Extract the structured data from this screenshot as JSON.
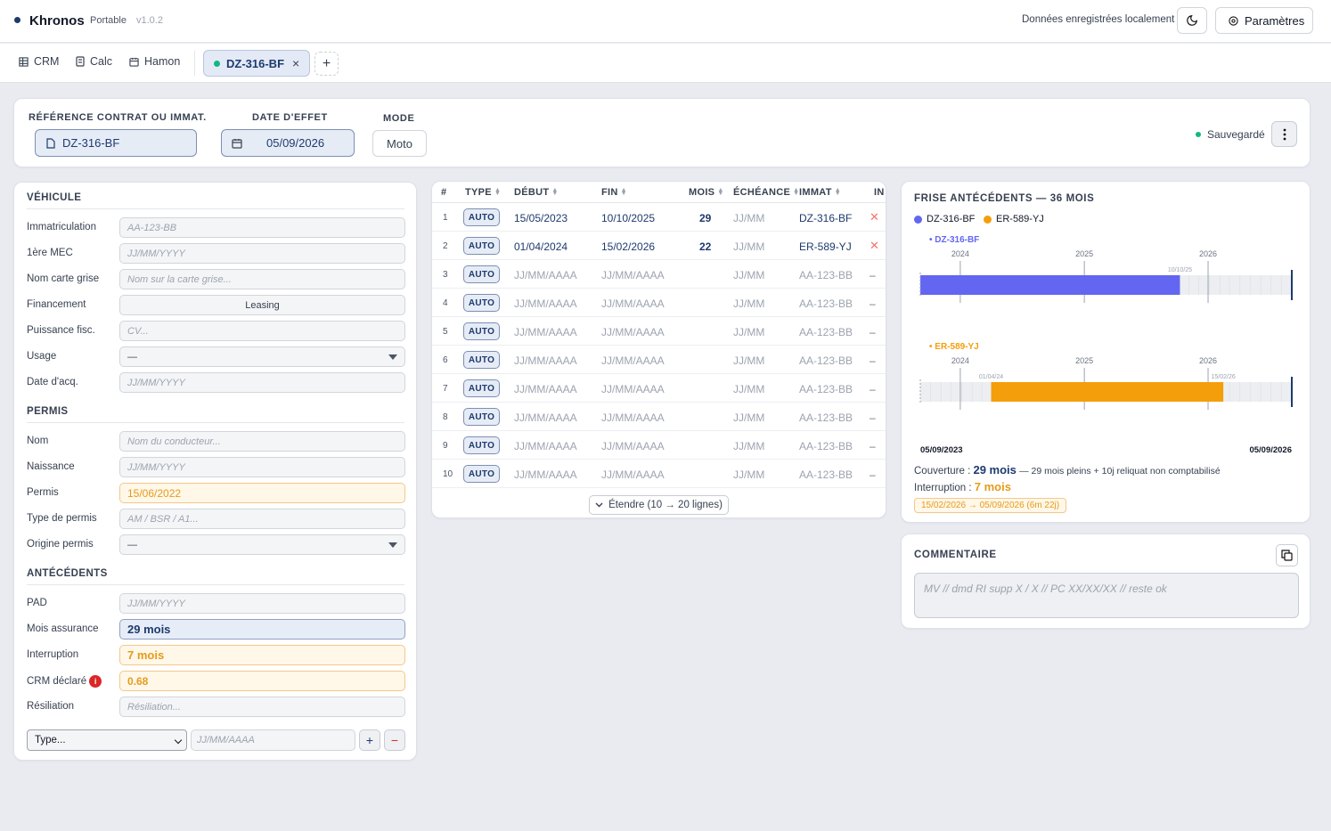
{
  "app": {
    "name": "Khronos",
    "edition": "Portable",
    "version": "v1.0.2",
    "storage_note": "Données enregistrées localement",
    "settings_label": "Paramètres"
  },
  "tabs": {
    "items": [
      {
        "label": "CRM"
      },
      {
        "label": "Calc"
      },
      {
        "label": "Hamon"
      }
    ],
    "active": {
      "label": "DZ-316-BF",
      "close": "×"
    },
    "add": "+"
  },
  "header": {
    "ref_label": "RÉFÉRENCE CONTRAT OU IMMAT.",
    "ref_value": "DZ-316-BF",
    "date_label": "DATE D'EFFET",
    "date_value": "05/09/2026",
    "mode_label": "MODE",
    "mode_value": "Moto",
    "status": "Sauvegardé"
  },
  "vehicule": {
    "title": "VÉHICULE",
    "fields": [
      {
        "label": "Immatriculation",
        "placeholder": "AA-123-BB"
      },
      {
        "label": "1ère MEC",
        "placeholder": "JJ/MM/YYYY"
      },
      {
        "label": "Nom carte grise",
        "placeholder": "Nom sur la carte grise..."
      },
      {
        "label": "Financement",
        "value": "Leasing"
      },
      {
        "label": "Puissance fisc.",
        "placeholder": "CV..."
      },
      {
        "label": "Usage",
        "value": "—"
      },
      {
        "label": "Date d'acq.",
        "placeholder": "JJ/MM/YYYY"
      }
    ]
  },
  "permis": {
    "title": "PERMIS",
    "fields": [
      {
        "label": "Nom",
        "placeholder": "Nom du conducteur..."
      },
      {
        "label": "Naissance",
        "placeholder": "JJ/MM/YYYY"
      },
      {
        "label": "Permis",
        "value": "15/06/2022"
      },
      {
        "label": "Type de permis",
        "placeholder": "AM / BSR / A1..."
      },
      {
        "label": "Origine permis",
        "value": "—"
      }
    ]
  },
  "antecedents": {
    "title": "ANTÉCÉDENTS",
    "fields": [
      {
        "label": "PAD",
        "placeholder": "JJ/MM/YYYY"
      },
      {
        "label": "Mois assurance",
        "value": "29 mois"
      },
      {
        "label": "Interruption",
        "value": "7 mois"
      },
      {
        "label": "CRM déclaré",
        "value": "0.68",
        "badge": "i"
      },
      {
        "label": "Résiliation",
        "placeholder": "Résiliation..."
      }
    ],
    "type_select": "Type...",
    "date_placeholder": "JJ/MM/AAAA",
    "add": "+",
    "remove": "−"
  },
  "table": {
    "headers": [
      "#",
      "TYPE",
      "DÉBUT",
      "FIN",
      "MOIS",
      "ÉCHÉANCE",
      "IMMAT",
      "IN"
    ],
    "rows": [
      {
        "n": "1",
        "type": "AUTO",
        "debut": "15/05/2023",
        "fin": "10/10/2025",
        "mois": "29",
        "echeance": "JJ/MM",
        "immat": "DZ-316-BF",
        "action": "✕"
      },
      {
        "n": "2",
        "type": "AUTO",
        "debut": "01/04/2024",
        "fin": "15/02/2026",
        "mois": "22",
        "echeance": "JJ/MM",
        "immat": "ER-589-YJ",
        "action": "✕"
      },
      {
        "n": "3",
        "type": "AUTO",
        "debut": "JJ/MM/AAAA",
        "fin": "JJ/MM/AAAA",
        "mois": "",
        "echeance": "JJ/MM",
        "immat": "AA-123-BB",
        "action": "–"
      },
      {
        "n": "4",
        "type": "AUTO",
        "debut": "JJ/MM/AAAA",
        "fin": "JJ/MM/AAAA",
        "mois": "",
        "echeance": "JJ/MM",
        "immat": "AA-123-BB",
        "action": "–"
      },
      {
        "n": "5",
        "type": "AUTO",
        "debut": "JJ/MM/AAAA",
        "fin": "JJ/MM/AAAA",
        "mois": "",
        "echeance": "JJ/MM",
        "immat": "AA-123-BB",
        "action": "–"
      },
      {
        "n": "6",
        "type": "AUTO",
        "debut": "JJ/MM/AAAA",
        "fin": "JJ/MM/AAAA",
        "mois": "",
        "echeance": "JJ/MM",
        "immat": "AA-123-BB",
        "action": "–"
      },
      {
        "n": "7",
        "type": "AUTO",
        "debut": "JJ/MM/AAAA",
        "fin": "JJ/MM/AAAA",
        "mois": "",
        "echeance": "JJ/MM",
        "immat": "AA-123-BB",
        "action": "–"
      },
      {
        "n": "8",
        "type": "AUTO",
        "debut": "JJ/MM/AAAA",
        "fin": "JJ/MM/AAAA",
        "mois": "",
        "echeance": "JJ/MM",
        "immat": "AA-123-BB",
        "action": "–"
      },
      {
        "n": "9",
        "type": "AUTO",
        "debut": "JJ/MM/AAAA",
        "fin": "JJ/MM/AAAA",
        "mois": "",
        "echeance": "JJ/MM",
        "immat": "AA-123-BB",
        "action": "–"
      },
      {
        "n": "10",
        "type": "AUTO",
        "debut": "JJ/MM/AAAA",
        "fin": "JJ/MM/AAAA",
        "mois": "",
        "echeance": "JJ/MM",
        "immat": "AA-123-BB",
        "action": "–"
      }
    ],
    "expand_label": "Étendre (10 → 20 lignes)"
  },
  "frise": {
    "title": "FRISE ANTÉCÉDENTS — 36 MOIS",
    "start_label": "05/09/2023",
    "end_label": "05/09/2026",
    "couverture_label": "Couverture :",
    "couverture_value": "29 mois",
    "couverture_detail": "— 29 mois pleins + 10j reliquat non comptabilisé",
    "interruption_label": "Interruption :",
    "interruption_value": "7 mois",
    "gap_chip": "15/02/2026 → 05/09/2026 (6m 22j)"
  },
  "chart_data": {
    "type": "timeline",
    "window": {
      "start": "2023-09-05",
      "end": "2026-09-05"
    },
    "year_ticks": [
      "2024",
      "2025",
      "2026"
    ],
    "series": [
      {
        "name": "DZ-316-BF",
        "color": "#6366f1",
        "start": "2023-05-15",
        "end": "2025-10-10",
        "start_label": "",
        "end_label": "10/10/25"
      },
      {
        "name": "ER-589-YJ",
        "color": "#f59e0b",
        "start": "2024-04-01",
        "end": "2026-02-15",
        "start_label": "01/04/24",
        "end_label": "15/02/26"
      }
    ]
  },
  "comment": {
    "title": "COMMENTAIRE",
    "placeholder": "MV // dmd RI supp X / X // PC XX/XX/XX // reste ok"
  }
}
